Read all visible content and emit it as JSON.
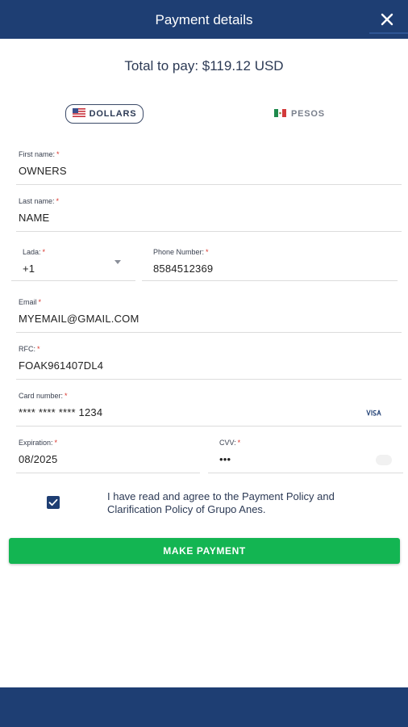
{
  "header": {
    "title": "Payment details",
    "close_icon": "close-icon"
  },
  "summary": {
    "total_text": "Total to pay: $119.12 USD"
  },
  "currency": {
    "dollars_label": "DOLLARS",
    "pesos_label": "PESOS",
    "selected": "DOLLARS"
  },
  "form": {
    "first_name": {
      "label": "First name:",
      "required": "*",
      "value": "OWNERS"
    },
    "last_name": {
      "label": "Last name:",
      "required": "*",
      "value": "NAME"
    },
    "lada": {
      "label": "Lada:",
      "required": "*",
      "value": "+1"
    },
    "phone": {
      "label": "Phone Number:",
      "required": "*",
      "value": "8584512369"
    },
    "email": {
      "label": "Email",
      "required": "*",
      "value": "MYEMAIL@GMAIL.COM"
    },
    "rfc": {
      "label": "RFC:",
      "required": "*",
      "value": "FOAK961407DL4"
    },
    "card_number": {
      "label": "Card number:",
      "required": "*",
      "value": "**** **** **** 1234",
      "brand_icon": "visa-icon"
    },
    "expiration": {
      "label": "Expiration:",
      "required": "*",
      "value": "08/2025"
    },
    "cvv": {
      "label": "CVV:",
      "required": "*",
      "value": "•••"
    }
  },
  "agreement": {
    "checked": true,
    "text": "I have read and agree to the Payment Policy and Clarification Policy of Grupo Anes."
  },
  "actions": {
    "make_payment_label": "MAKE PAYMENT"
  },
  "colors": {
    "header_bg": "#1e3e73",
    "button_green": "#13b552",
    "required_red": "#d9342b"
  }
}
